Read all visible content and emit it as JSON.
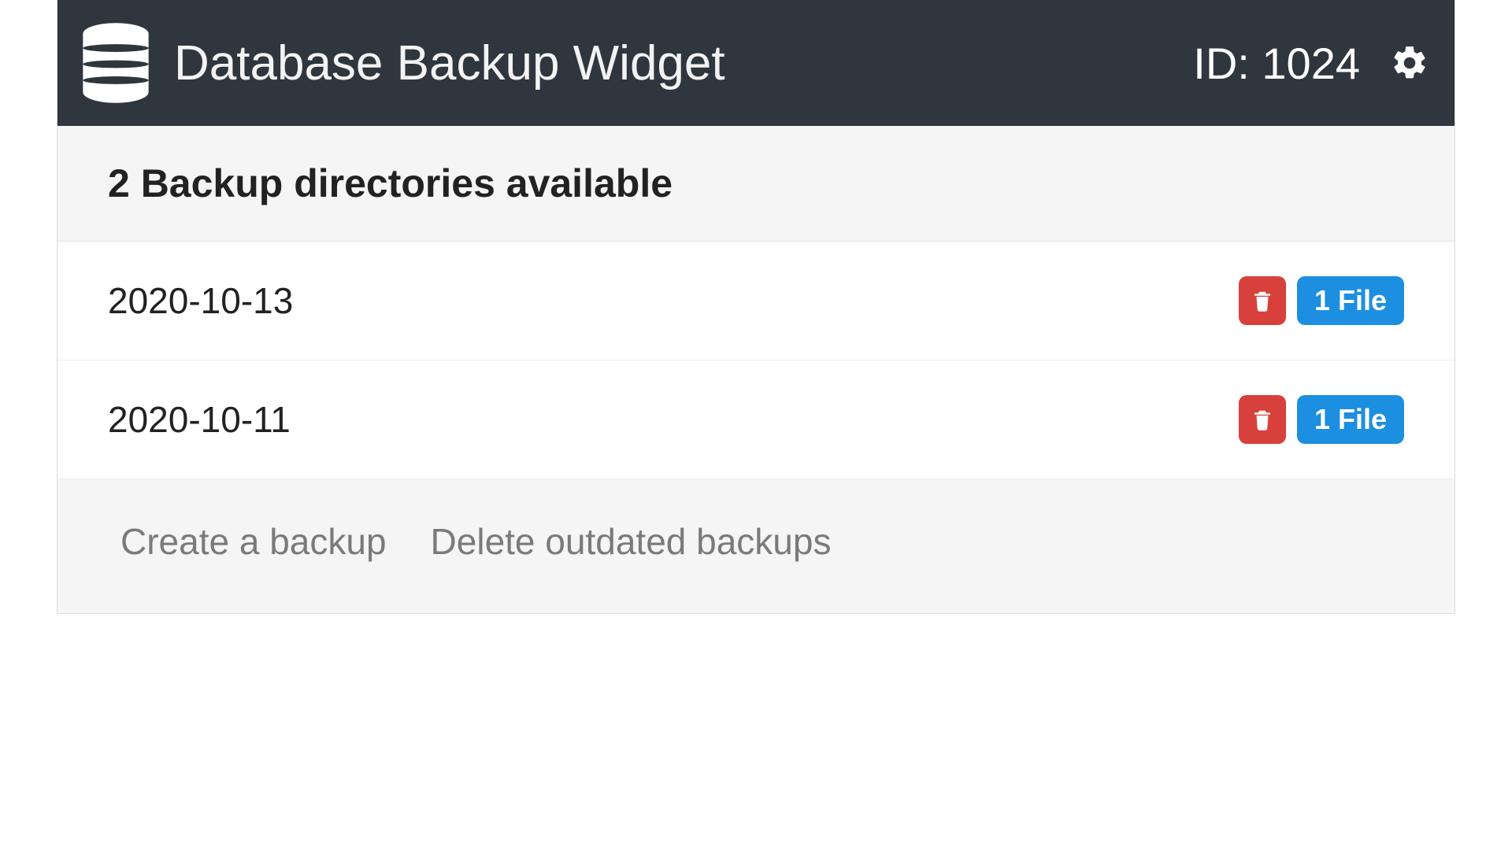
{
  "header": {
    "title": "Database Backup Widget",
    "id_label": "ID: 1024"
  },
  "subheader": {
    "text": "2 Backup directories available"
  },
  "rows": [
    {
      "date": "2020-10-13",
      "file_badge": "1 File"
    },
    {
      "date": "2020-10-11",
      "file_badge": "1 File"
    }
  ],
  "footer": {
    "create_label": "Create a backup",
    "delete_outdated_label": "Delete outdated backups"
  }
}
